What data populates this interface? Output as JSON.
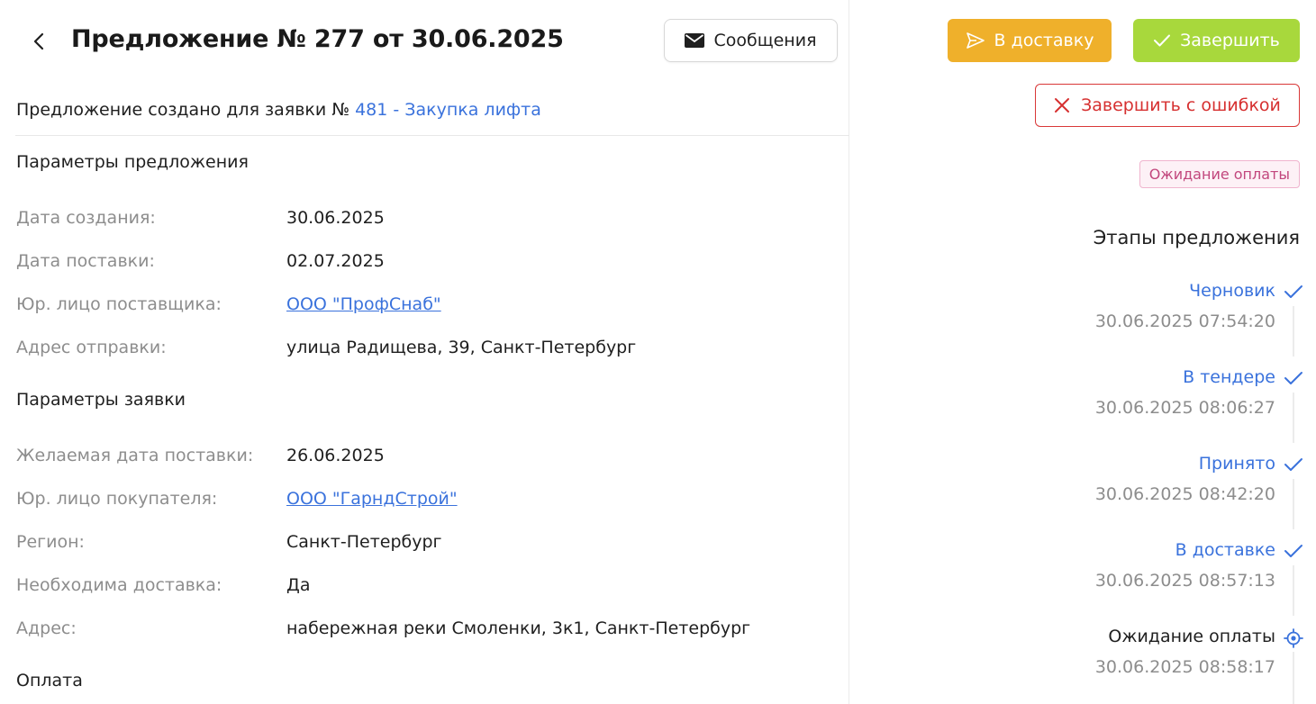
{
  "header": {
    "title": "Предложение № 277 от 30.06.2025",
    "messages_label": "Сообщения"
  },
  "request_link": {
    "prefix": "Предложение создано для заявки №",
    "link_text": "481 - Закупка лифта"
  },
  "offer_params": {
    "title": "Параметры предложения",
    "fields": [
      {
        "label": "Дата создания:",
        "value": "30.06.2025"
      },
      {
        "label": "Дата поставки:",
        "value": "02.07.2025"
      },
      {
        "label": "Юр. лицо поставщика:",
        "value": "ООО \"ПрофСнаб\""
      },
      {
        "label": "Адрес отправки:",
        "value": "улица Радищева, 39, Санкт-Петербург"
      }
    ]
  },
  "request_params": {
    "title": "Параметры заявки",
    "fields": [
      {
        "label": "Желаемая дата поставки:",
        "value": "26.06.2025"
      },
      {
        "label": "Юр. лицо покупателя:",
        "value": "ООО \"ГарндСтрой\""
      },
      {
        "label": "Регион:",
        "value": "Санкт-Петербург"
      },
      {
        "label": "Необходима доставка:",
        "value": "Да"
      },
      {
        "label": "Адрес:",
        "value": "набережная реки Смоленки, 3к1, Санкт-Петербург"
      }
    ]
  },
  "payment": {
    "title": "Оплата"
  },
  "actions": {
    "delivery_label": "В доставку",
    "finish_label": "Завершить",
    "finish_error_label": "Завершить с ошибкой"
  },
  "status": {
    "label": "Ожидание оплаты"
  },
  "stages": {
    "title": "Этапы предложения",
    "items": [
      {
        "name": "Черновик",
        "time": "30.06.2025 07:54:20",
        "state": "done"
      },
      {
        "name": "В тендере",
        "time": "30.06.2025 08:06:27",
        "state": "done"
      },
      {
        "name": "Принято",
        "time": "30.06.2025 08:42:20",
        "state": "done"
      },
      {
        "name": "В доставке",
        "time": "30.06.2025 08:57:13",
        "state": "done"
      },
      {
        "name": "Ожидание оплаты",
        "time": "30.06.2025 08:58:17",
        "state": "current"
      }
    ]
  },
  "colors": {
    "link": "#3a72dc",
    "delivery_button": "#efb02b",
    "finish_button": "#a8d83c",
    "error": "#d63030",
    "status_badge_text": "#c2477d",
    "status_badge_bg": "#fdf1f6"
  },
  "icons": {
    "back": "chevron-left-icon",
    "messages": "envelope-icon",
    "delivery": "send-icon",
    "finish": "check-icon",
    "finish_error": "close-icon",
    "stage_done": "check-icon",
    "stage_current": "target-icon"
  }
}
